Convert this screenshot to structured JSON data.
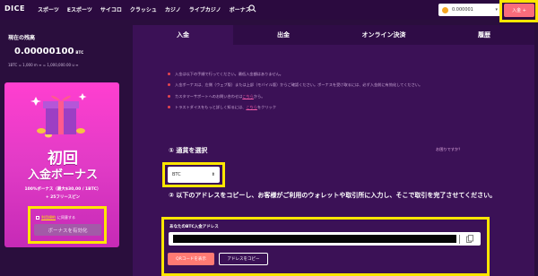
{
  "brand": "DICE",
  "nav": {
    "items": [
      "スポーツ",
      "Eスポーツ",
      "サイコロ",
      "クラッシュ",
      "カジノ",
      "ライブカジノ",
      "ボーナス"
    ]
  },
  "wallet": {
    "amount": "0.000001"
  },
  "header": {
    "deposit_label": "入金 +"
  },
  "balance": {
    "label": "現在の残高",
    "value": "0.00000100",
    "unit": "BTC",
    "conversion": "1BTC = 1,000 m ≡ = 1,000,000.00 u ≡"
  },
  "promo": {
    "title1": "初回",
    "title2": "入金ボーナス",
    "detail": "100%ボーナス（最大$30,00 / 1BTC）",
    "spins": "+ 25フリースピン",
    "agree_link": "利用規約",
    "agree_suffix": "に同意する",
    "activate_label": "ボーナスを有効化"
  },
  "tabs": [
    {
      "label": "入金",
      "active": true
    },
    {
      "label": "出金",
      "active": false
    },
    {
      "label": "オンライン決済",
      "active": false
    },
    {
      "label": "履歴",
      "active": false
    }
  ],
  "notes": [
    {
      "text": "入金は以下の手順で行ってください。最低入金額はありません。"
    },
    {
      "text": "入金ボーナスは、左側（ウェブ版）または上部（モバイル版）からご確認ください。ボーナスを受け取るには、必ず入金前に有効化してください。"
    },
    {
      "text": "カスタマーサポートへのお問い合わせは",
      "link": "こちら",
      "suffix": "から。"
    },
    {
      "text": "トラストダイスをもっと詳しく知るには、",
      "link": "こちら",
      "suffix": "をクリック"
    }
  ],
  "step1": {
    "label": "① 通貨を選択",
    "help": "お困りですか？",
    "currency": "BTC"
  },
  "step2": {
    "label": "② 以下のアドレスをコピーし、お客様がご利用のウォレットや取引所に入力し、そこで取引を完了させてください。",
    "address_label": "あなたのBTC入金アドレス",
    "qr_label": "QRコードを表示",
    "copy_label": "アドレスをコピー"
  }
}
